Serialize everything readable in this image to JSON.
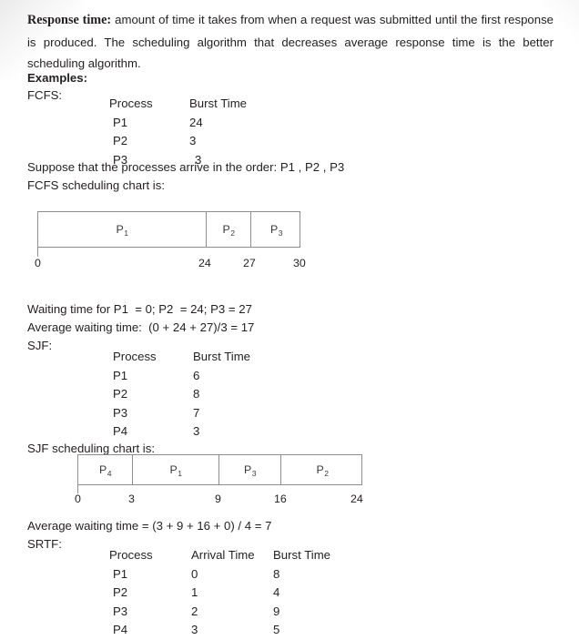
{
  "document": {
    "paragraph": {
      "lead": "Response time:",
      "body": " amount of time it takes from when a request was submitted until the first response is produced. The scheduling algorithm that decreases average response time is the better scheduling algorithm."
    },
    "examples_heading": "Examples:",
    "sections": [
      {
        "label": "FCFS:",
        "table": {
          "headers": [
            "Process",
            "Burst Time"
          ],
          "rows": [
            [
              "P1",
              "24"
            ],
            [
              "P2",
              "3"
            ],
            [
              "P3",
              "3"
            ]
          ]
        },
        "note_arrival_order": "Suppose that the processes arrive in the order: P1 , P2 , P3",
        "chart_caption": "FCFS scheduling chart is:",
        "waiting_time_line": "Waiting time for P1  = 0; P2  = 24; P3 = 27",
        "average_waiting_time_line": "Average waiting time:  (0 + 24 + 27)/3 = 17"
      },
      {
        "label": "SJF:",
        "table": {
          "headers": [
            "Process",
            "Burst Time"
          ],
          "rows": [
            [
              "P1",
              "6"
            ],
            [
              "P2",
              "8"
            ],
            [
              "P3",
              "7"
            ],
            [
              "P4",
              "3"
            ]
          ]
        },
        "chart_caption": "SJF scheduling chart is:",
        "average_waiting_time_line": "Average waiting time = (3 + 9 + 16 + 0) / 4 = 7"
      },
      {
        "label": "SRTF:",
        "table": {
          "headers": [
            "Process",
            "Arrival Time",
            "Burst Time"
          ],
          "rows": [
            [
              "P1",
              "0",
              "8"
            ],
            [
              "P2",
              "1",
              "4"
            ],
            [
              "P3",
              "2",
              "9"
            ],
            [
              "P4",
              "3",
              "5"
            ]
          ]
        }
      }
    ]
  },
  "chart_data": [
    {
      "type": "gantt",
      "name": "fcfs-gantt-chart",
      "title": "FCFS scheduling chart is:",
      "axis_start": 0,
      "axis_end": 30,
      "ticks": [
        0,
        24,
        27,
        30
      ],
      "segments": [
        {
          "process": "P",
          "index": "1",
          "start": 0,
          "end": 24
        },
        {
          "process": "P",
          "index": "2",
          "start": 24,
          "end": 27
        },
        {
          "process": "P",
          "index": "3",
          "start": 27,
          "end": 30
        }
      ]
    },
    {
      "type": "gantt",
      "name": "sjf-gantt-chart",
      "title": "SJF scheduling chart is:",
      "axis_start": 0,
      "axis_end": 24,
      "ticks": [
        0,
        3,
        9,
        16,
        24
      ],
      "segments": [
        {
          "process": "P",
          "index": "4",
          "start": 0,
          "end": 3
        },
        {
          "process": "P",
          "index": "1",
          "start": 3,
          "end": 9
        },
        {
          "process": "P",
          "index": "3",
          "start": 9,
          "end": 16
        },
        {
          "process": "P",
          "index": "2",
          "start": 16,
          "end": 24
        }
      ]
    }
  ]
}
